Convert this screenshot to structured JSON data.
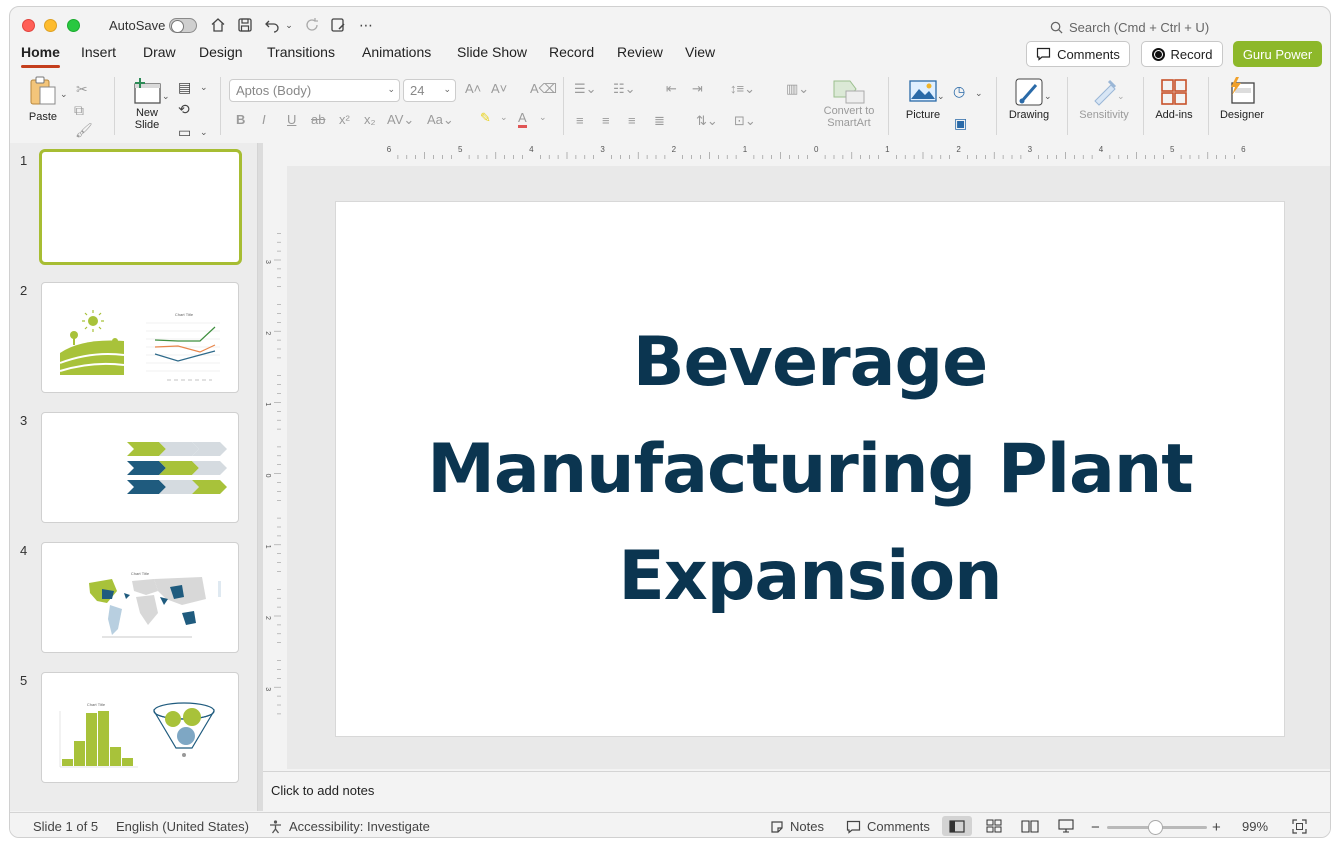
{
  "titlebar": {
    "autosave_label": "AutoSave",
    "search_placeholder": "Search (Cmd + Ctrl + U)"
  },
  "tabs": [
    "Home",
    "Insert",
    "Draw",
    "Design",
    "Transitions",
    "Animations",
    "Slide Show",
    "Record",
    "Review",
    "View"
  ],
  "active_tab": "Home",
  "header_buttons": {
    "comments": "Comments",
    "record": "Record",
    "guru": "Guru Power"
  },
  "ribbon": {
    "paste": "Paste",
    "new_slide_line1": "New",
    "new_slide_line2": "Slide",
    "font_name": "Aptos (Body)",
    "font_size": "24",
    "convert_line1": "Convert to",
    "convert_line2": "SmartArt",
    "picture": "Picture",
    "drawing": "Drawing",
    "sensitivity": "Sensitivity",
    "addins": "Add-ins",
    "designer": "Designer"
  },
  "thumbnails": {
    "numbers": [
      "1",
      "2",
      "3",
      "4",
      "5"
    ],
    "t2_chart_title": "Chart Title",
    "t4_chart_title": "Chart Title",
    "t5_chart_title": "Chart Title"
  },
  "ruler": {
    "top_labels": [
      "6",
      "5",
      "4",
      "3",
      "2",
      "1",
      "0",
      "1",
      "2",
      "3",
      "4",
      "5",
      "6"
    ],
    "left_labels": [
      "3",
      "2",
      "1",
      "0",
      "1",
      "2",
      "3"
    ]
  },
  "slide": {
    "title_line1": "Beverage",
    "title_line2": "Manufacturing Plant",
    "title_line3": "Expansion"
  },
  "notes_placeholder": "Click to add notes",
  "status": {
    "slide_counter": "Slide 1 of 5",
    "language": "English (United States)",
    "accessibility": "Accessibility: Investigate",
    "notes": "Notes",
    "comments": "Comments",
    "zoom_minus": "−",
    "zoom_plus": "+",
    "zoom_percent": "99%"
  },
  "colors": {
    "accent_green": "#8db82a",
    "slide_title": "#0b3550",
    "tab_underline": "#c43e1c"
  }
}
